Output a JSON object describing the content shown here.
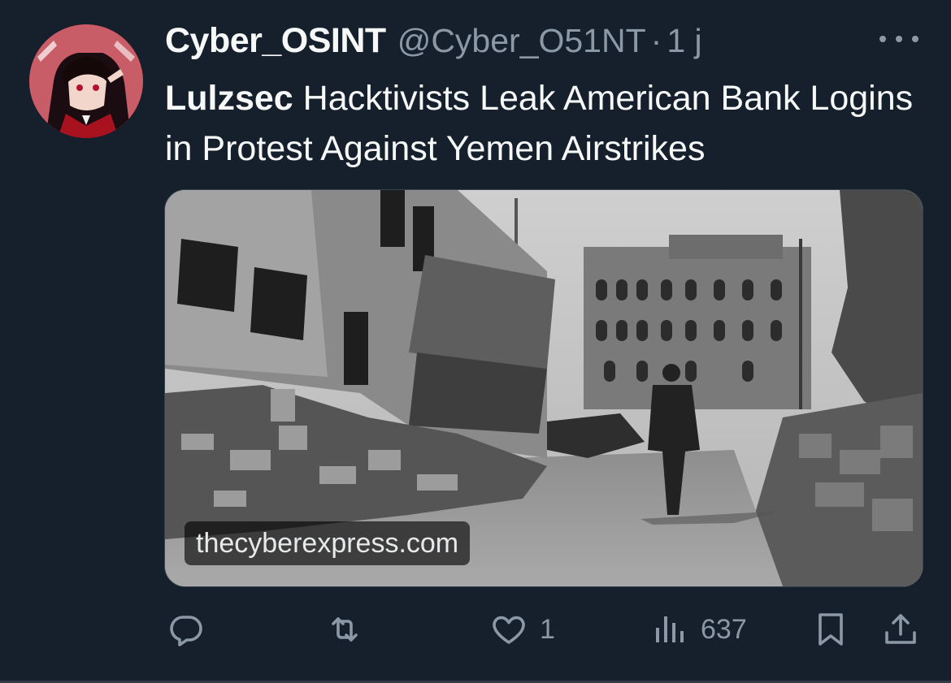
{
  "tweet": {
    "author": {
      "display_name": "Cyber_OSINT",
      "handle": "@Cyber_O51NT",
      "separator": "·",
      "time": "1 j",
      "avatar_icon": "profile-avatar-anime-character"
    },
    "text_bold": "Lulzsec",
    "text_rest": " Hacktivists Leak American Bank Logins in Protest Against Yemen Airstrikes",
    "media": {
      "domain": "thecyberexpress.com",
      "description_icon": "photo-destroyed-buildings"
    },
    "actions": {
      "reply": {
        "icon": "reply-icon",
        "count": ""
      },
      "retweet": {
        "icon": "retweet-icon",
        "count": ""
      },
      "like": {
        "icon": "heart-icon",
        "count": "1"
      },
      "views": {
        "icon": "views-icon",
        "count": "637"
      },
      "bookmark": {
        "icon": "bookmark-icon"
      },
      "share": {
        "icon": "share-icon"
      }
    },
    "more_icon": "more-icon"
  },
  "colors": {
    "background": "#16202c",
    "text_primary": "#f7f9f9",
    "text_secondary": "#8b98a5"
  }
}
